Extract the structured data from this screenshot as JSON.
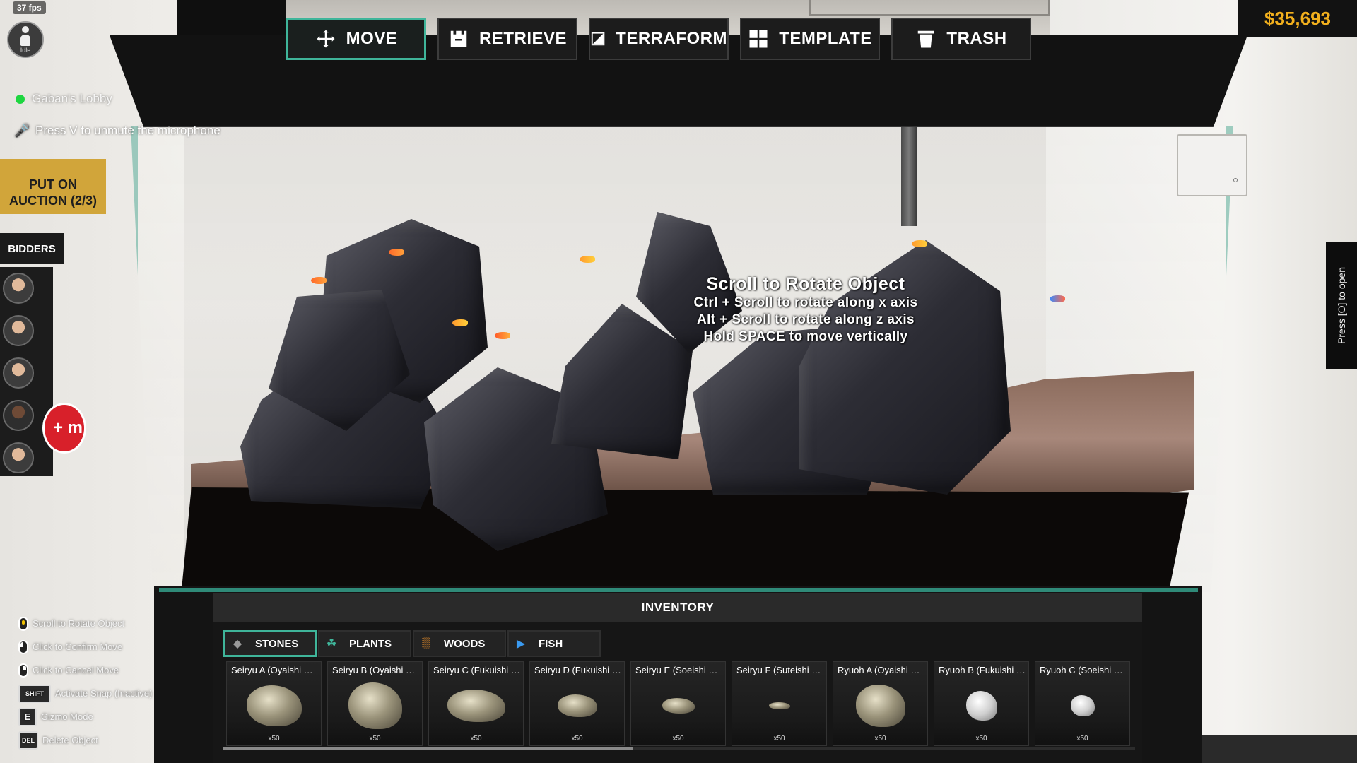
{
  "hud": {
    "fps": "37 fps",
    "status": "Idle",
    "lobby": "Gaban's Lobby",
    "mic_hint": "Press V to unmute the microphone",
    "auction_button": "PUT ON\nAUCTION (2/3)",
    "bidders_label": "BIDDERS",
    "bidders": [
      "bidder-1",
      "bidder-2",
      "bidder-3",
      "bidder-4",
      "bidder-5"
    ],
    "red_badge_text": "+ m",
    "money": "$35,693",
    "side_tab": "Press [O] to open"
  },
  "toolbar": {
    "items": [
      {
        "label": "MOVE",
        "icon": "move-icon",
        "active": true
      },
      {
        "label": "RETRIEVE",
        "icon": "retrieve-icon",
        "active": false
      },
      {
        "label": "TERRAFORM",
        "icon": "terraform-icon",
        "active": false
      },
      {
        "label": "TEMPLATE",
        "icon": "template-icon",
        "active": false
      },
      {
        "label": "TRASH",
        "icon": "trash-icon",
        "active": false
      }
    ]
  },
  "rotate_hint": {
    "title": "Scroll to Rotate Object",
    "lines": [
      "Ctrl + Scroll to rotate along x axis",
      "Alt + Scroll to rotate along z axis",
      "Hold SPACE to move vertically"
    ]
  },
  "controls": [
    {
      "key": "scroll",
      "label": "Scroll to Rotate Object"
    },
    {
      "key": "left-click",
      "label": "Click to Confirm Move"
    },
    {
      "key": "right-click",
      "label": "Click to Cancel Move"
    },
    {
      "key": "SHIFT",
      "label": "Activate Snap (Inactive)"
    },
    {
      "key": "E",
      "label": "Gizmo Mode"
    },
    {
      "key": "DEL",
      "label": "Delete Object"
    }
  ],
  "inventory": {
    "title": "INVENTORY",
    "tabs": [
      {
        "label": "STONES",
        "icon": "stone-icon",
        "active": true
      },
      {
        "label": "PLANTS",
        "icon": "plant-icon",
        "active": false
      },
      {
        "label": "WOODS",
        "icon": "wood-icon",
        "active": false
      },
      {
        "label": "FISH",
        "icon": "fish-icon",
        "active": false
      }
    ],
    "items": [
      {
        "name": "Seiryu A (Oyaishi Si...",
        "qty": "x50"
      },
      {
        "name": "Seiryu B (Oyaishi Si...",
        "qty": "x50"
      },
      {
        "name": "Seiryu C (Fukuishi S...",
        "qty": "x50"
      },
      {
        "name": "Seiryu D (Fukuishi S...",
        "qty": "x50"
      },
      {
        "name": "Seiryu E (Soeishi Si...",
        "qty": "x50"
      },
      {
        "name": "Seiryu F (Suteishi Si...",
        "qty": "x50"
      },
      {
        "name": "Ryuoh A (Oyaishi Siz...",
        "qty": "x50"
      },
      {
        "name": "Ryuoh B (Fukuishi S...",
        "qty": "x50"
      },
      {
        "name": "Ryuoh C (Soeishi Si...",
        "qty": "x50"
      }
    ]
  },
  "colors": {
    "accent": "#3fb59a",
    "money": "#f2b01d",
    "auction": "#d1a53a",
    "online": "#1ed640",
    "mic_muted": "#e23a3a"
  }
}
